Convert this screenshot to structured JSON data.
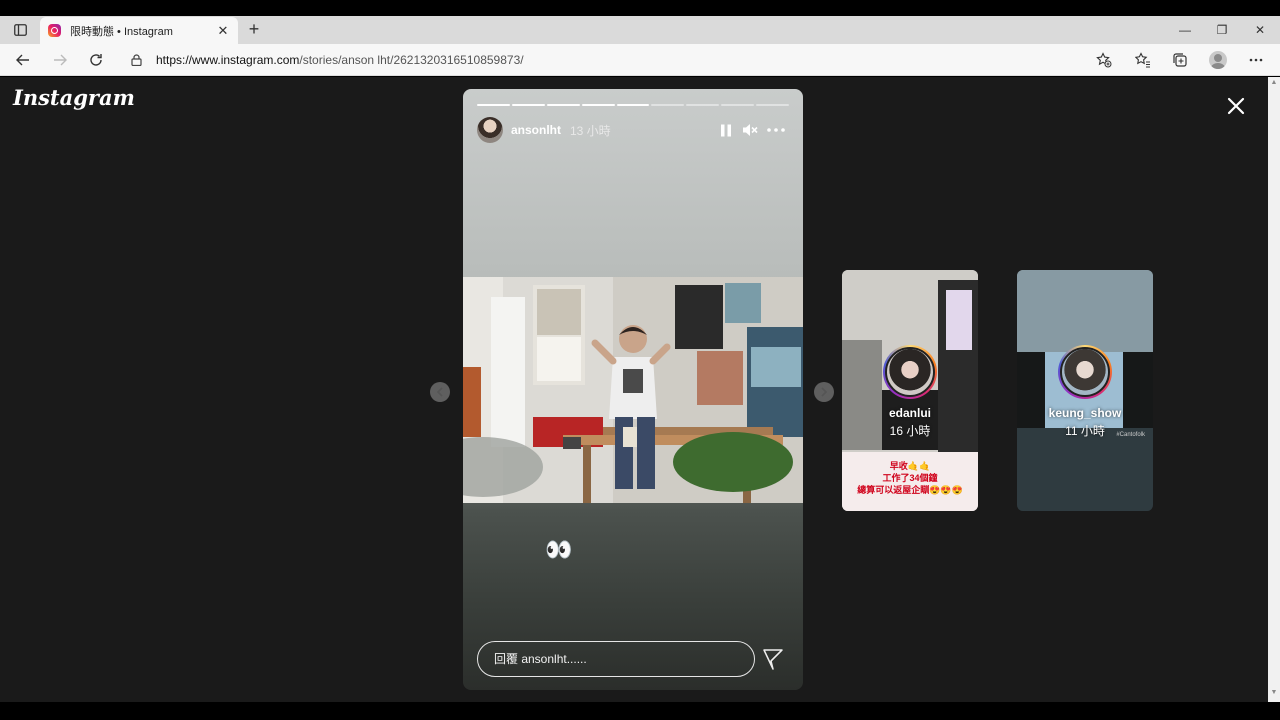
{
  "browser": {
    "tab": {
      "title": "限時動態 • Instagram",
      "close": "✕"
    },
    "new_tab": "+",
    "window_controls": {
      "minimize": "—",
      "restore": "❐",
      "close": "✕"
    },
    "url": {
      "host": "https://www.instagram.com",
      "path": "/stories/anson lht/2621320316510859873/"
    }
  },
  "page": {
    "logo": "Instagram",
    "story": {
      "progress": {
        "segments": 9,
        "completed": 5
      },
      "username": "ansonlht",
      "time": "13 小時",
      "emoji": "👀",
      "reply_placeholder": "回覆 ansonlht......"
    },
    "next_stories": [
      {
        "username": "edanlui",
        "time": "16 小時",
        "caption": [
          "早收🤙🤙",
          "工作了34個鐘",
          "總算可以返屋企瞓😍😍😍"
        ]
      },
      {
        "username": "keung_show",
        "time": "11 小時",
        "tag": "#Cantofolk"
      }
    ]
  },
  "colors": {
    "page_bg": "#1a1a1a",
    "instagram_ring": "#d62976"
  }
}
